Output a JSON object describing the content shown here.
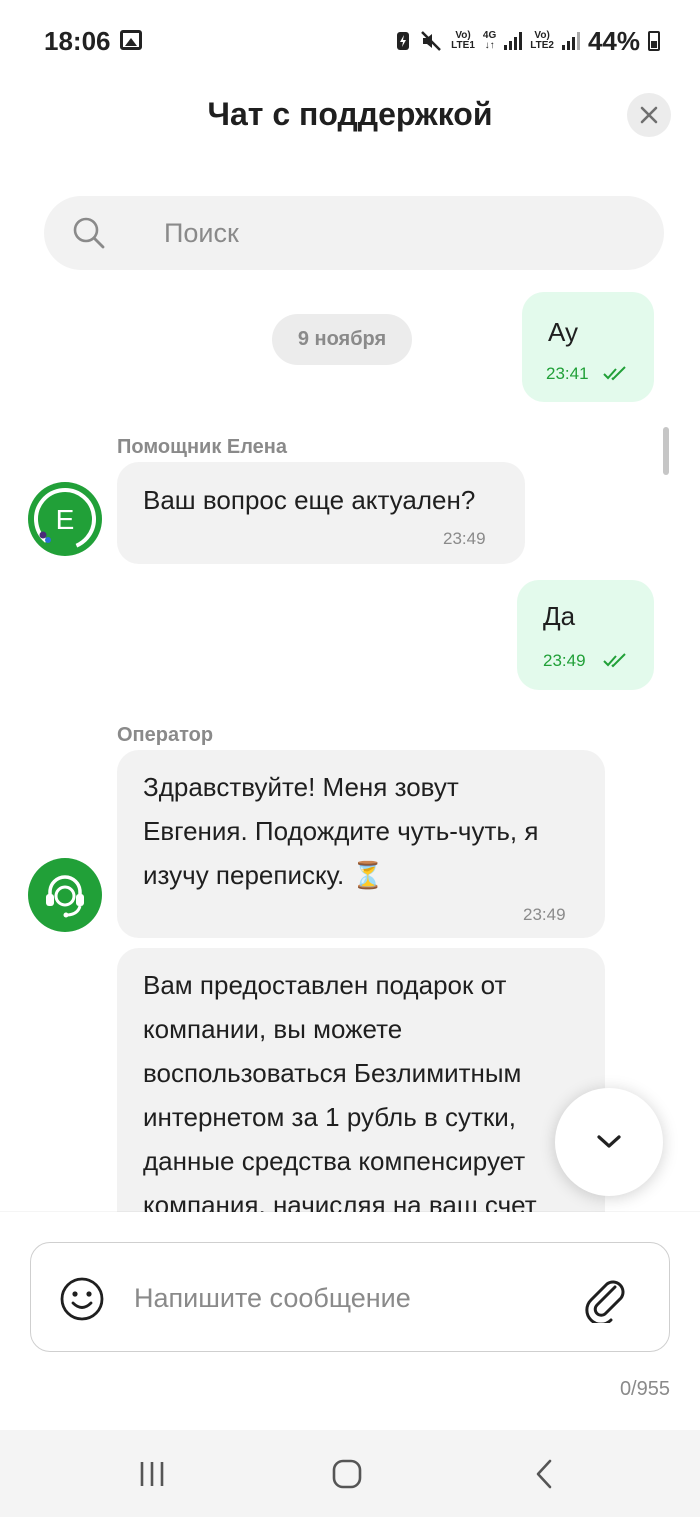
{
  "status_bar": {
    "time": "18:06",
    "sim1_label_top": "Vo)",
    "sim1_label_bottom": "LTE1",
    "network_top": "4G",
    "network_bottom": "↓↑",
    "sim2_label_top": "Vo)",
    "sim2_label_bottom": "LTE2",
    "battery": "44%"
  },
  "header": {
    "title": "Чат с поддержкой"
  },
  "search": {
    "placeholder": "Поиск"
  },
  "chat": {
    "date_separator": "9 ноября",
    "messages": [
      {
        "direction": "out",
        "text": "Ау",
        "time": "23:41"
      },
      {
        "direction": "in",
        "sender": "Помощник Елена",
        "avatar_letter": "E",
        "text": "Ваш вопрос еще актуален?",
        "time": "23:49"
      },
      {
        "direction": "out",
        "text": "Да",
        "time": "23:49"
      },
      {
        "direction": "in",
        "sender": "Оператор",
        "lines": [
          "Здравствуйте! Меня зовут",
          "Евгения. Подождите чуть-чуть, я",
          "изучу переписку. ⏳"
        ],
        "time": "23:49"
      },
      {
        "direction": "in",
        "lines": [
          "Вам предоставлен подарок от",
          "компании, вы можете",
          "воспользоваться Безлимитным",
          "интернетом за 1 рубль в сутки,",
          "данные средства компенсирует",
          "компания, начисляя на ваш счет"
        ]
      }
    ]
  },
  "composer": {
    "placeholder": "Напишите сообщение",
    "counter": "0/955"
  },
  "colors": {
    "accent_green": "#21a038",
    "outgoing_bubble": "#e3faec",
    "incoming_bubble": "#f2f2f2"
  },
  "icons": {
    "close": "close-icon",
    "search": "search-icon",
    "scroll_down": "chevron-down-icon",
    "emoji": "emoji-icon",
    "attach": "paperclip-icon",
    "operator_avatar": "headset-icon"
  }
}
